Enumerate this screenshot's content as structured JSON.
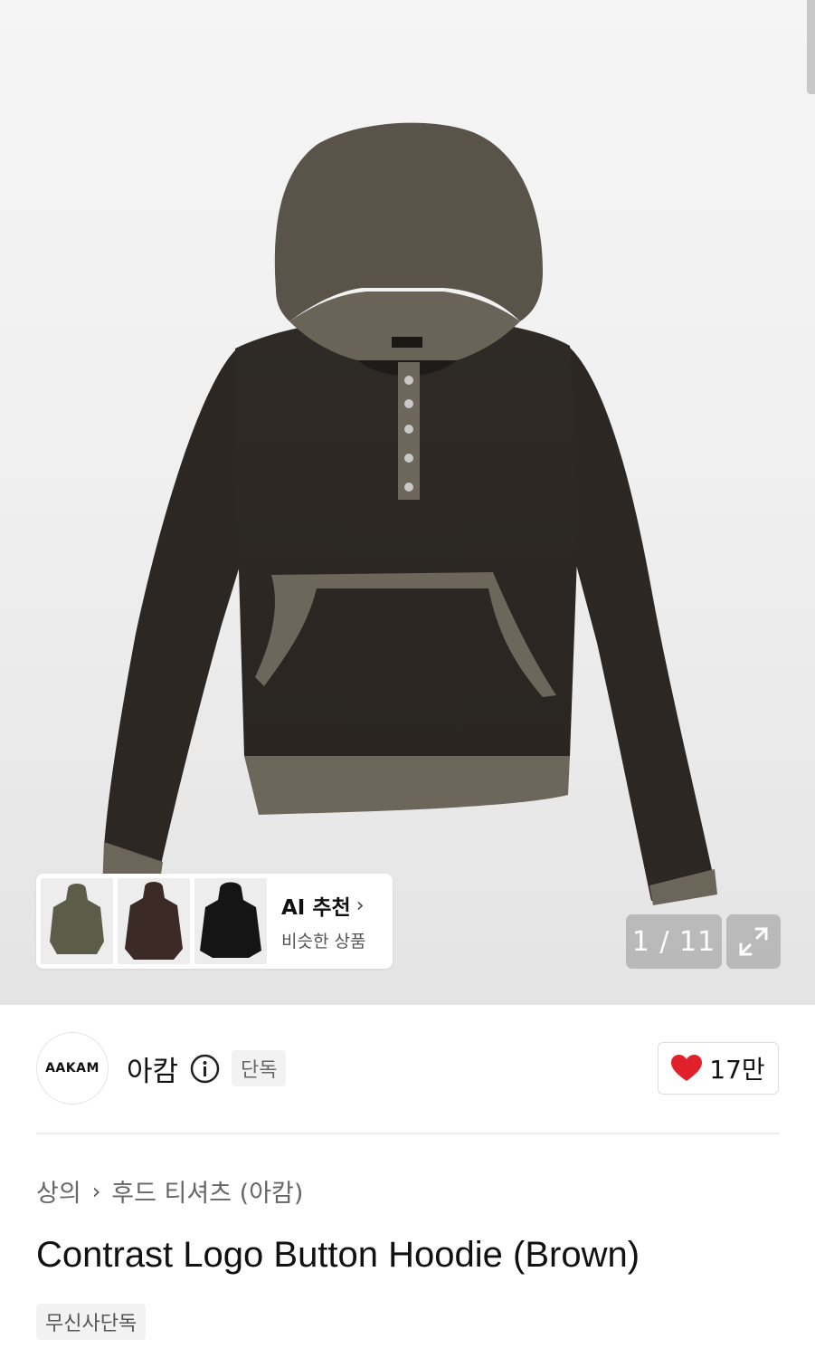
{
  "gallery": {
    "counter": "1 / 11",
    "ai_recommend": {
      "title": "AI 추천",
      "subtitle": "비슷한 상품"
    }
  },
  "brand": {
    "logo_text": "AAKAM",
    "name": "아캄",
    "exclusive_badge": "단독"
  },
  "like": {
    "count": "17만"
  },
  "breadcrumb": {
    "category": "상의",
    "subcategory": "후드 티셔츠 (아캄)"
  },
  "product": {
    "title": "Contrast Logo Button Hoodie (Brown)",
    "tag": "무신사단독"
  },
  "colors": {
    "like_heart": "#e0202b",
    "body": "#312c27",
    "rib": "#6d665b"
  }
}
